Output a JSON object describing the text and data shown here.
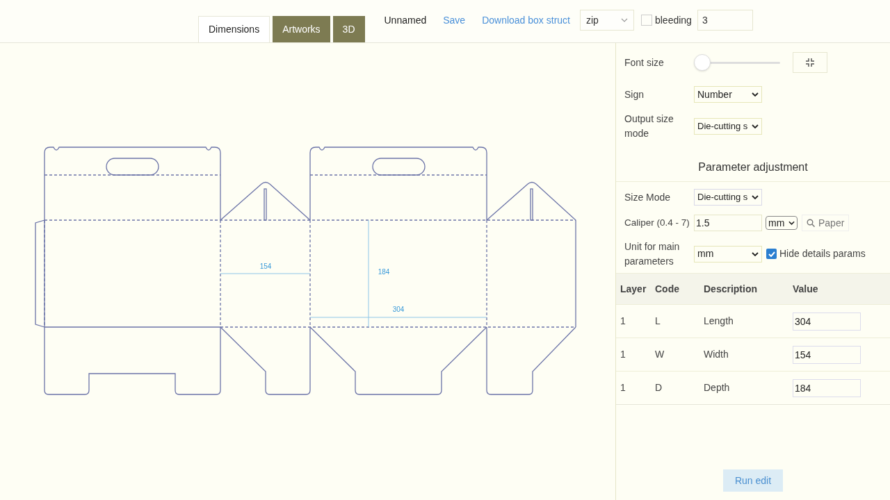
{
  "tabs": [
    {
      "label": "Dimensions",
      "selected": true
    },
    {
      "label": "Artworks",
      "selected": false
    },
    {
      "label": "3D",
      "selected": false
    }
  ],
  "toolbar": {
    "file_name": "Unnamed",
    "save": "Save",
    "download": "Download box struct",
    "format": "zip",
    "bleeding": {
      "label": "bleeding",
      "checked": false,
      "value": "3"
    }
  },
  "dieline": {
    "dimension_labels": [
      "154",
      "184",
      "304"
    ]
  },
  "settings": {
    "font_size": {
      "label": "Font size",
      "level": 0.0
    },
    "sign": {
      "label": "Sign",
      "value": "Number"
    },
    "output_size_mode": {
      "label": "Output size mode",
      "value": "Die-cutting s"
    },
    "section_title": "Parameter adjustment",
    "size_mode": {
      "label": "Size Mode",
      "value": "Die-cutting s"
    },
    "caliper": {
      "label": "Caliper (0.4 - 7)",
      "value": "1.5",
      "unit": "mm",
      "paper_button": "Paper"
    },
    "main_unit": {
      "label": "Unit for main parameters",
      "value": "mm"
    },
    "hide_details": {
      "label": "Hide details params",
      "checked": true
    }
  },
  "table": {
    "columns": [
      "Layer",
      "Code",
      "Description",
      "Value"
    ],
    "rows": [
      {
        "layer": "1",
        "code": "L",
        "description": "Length",
        "value": "304"
      },
      {
        "layer": "1",
        "code": "W",
        "description": "Width",
        "value": "154"
      },
      {
        "layer": "1",
        "code": "D",
        "description": "Depth",
        "value": "184"
      }
    ]
  },
  "run_button": "Run edit"
}
